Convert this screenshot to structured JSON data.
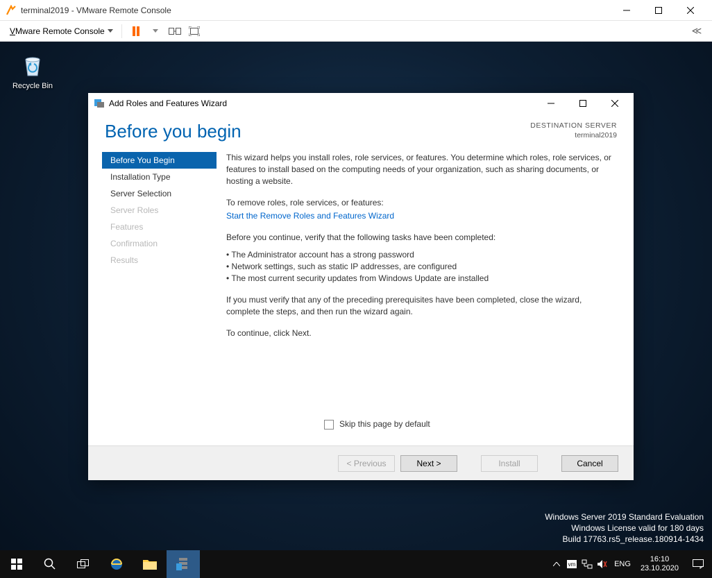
{
  "vm": {
    "title": "terminal2019 - VMware Remote Console",
    "menu_label": "Mware Remote Console",
    "menu_first_letter": "V"
  },
  "desktop": {
    "recycle_label": "Recycle Bin",
    "watermark": {
      "line1": "Windows Server 2019 Standard Evaluation",
      "line2": "Windows License valid for 180 days",
      "line3": "Build 17763.rs5_release.180914-1434"
    }
  },
  "wizard": {
    "window_title": "Add Roles and Features Wizard",
    "heading": "Before you begin",
    "dest_label": "DESTINATION SERVER",
    "dest_server": "terminal2019",
    "nav": [
      {
        "label": "Before You Begin",
        "selected": true,
        "disabled": false
      },
      {
        "label": "Installation Type",
        "selected": false,
        "disabled": false
      },
      {
        "label": "Server Selection",
        "selected": false,
        "disabled": false
      },
      {
        "label": "Server Roles",
        "selected": false,
        "disabled": true
      },
      {
        "label": "Features",
        "selected": false,
        "disabled": true
      },
      {
        "label": "Confirmation",
        "selected": false,
        "disabled": true
      },
      {
        "label": "Results",
        "selected": false,
        "disabled": true
      }
    ],
    "content": {
      "p1": "This wizard helps you install roles, role services, or features. You determine which roles, role services, or features to install based on the computing needs of your organization, such as sharing documents, or hosting a website.",
      "p2": "To remove roles, role services, or features:",
      "link": "Start the Remove Roles and Features Wizard",
      "p3": "Before you continue, verify that the following tasks have been completed:",
      "bullets": [
        "The Administrator account has a strong password",
        "Network settings, such as static IP addresses, are configured",
        "The most current security updates from Windows Update are installed"
      ],
      "p4": "If you must verify that any of the preceding prerequisites have been completed, close the wizard, complete the steps, and then run the wizard again.",
      "p5": "To continue, click Next.",
      "skip_label": "Skip this page by default"
    },
    "buttons": {
      "previous": "< Previous",
      "next": "Next >",
      "install": "Install",
      "cancel": "Cancel"
    }
  },
  "taskbar": {
    "lang": "ENG",
    "time": "16:10",
    "date": "23.10.2020"
  }
}
